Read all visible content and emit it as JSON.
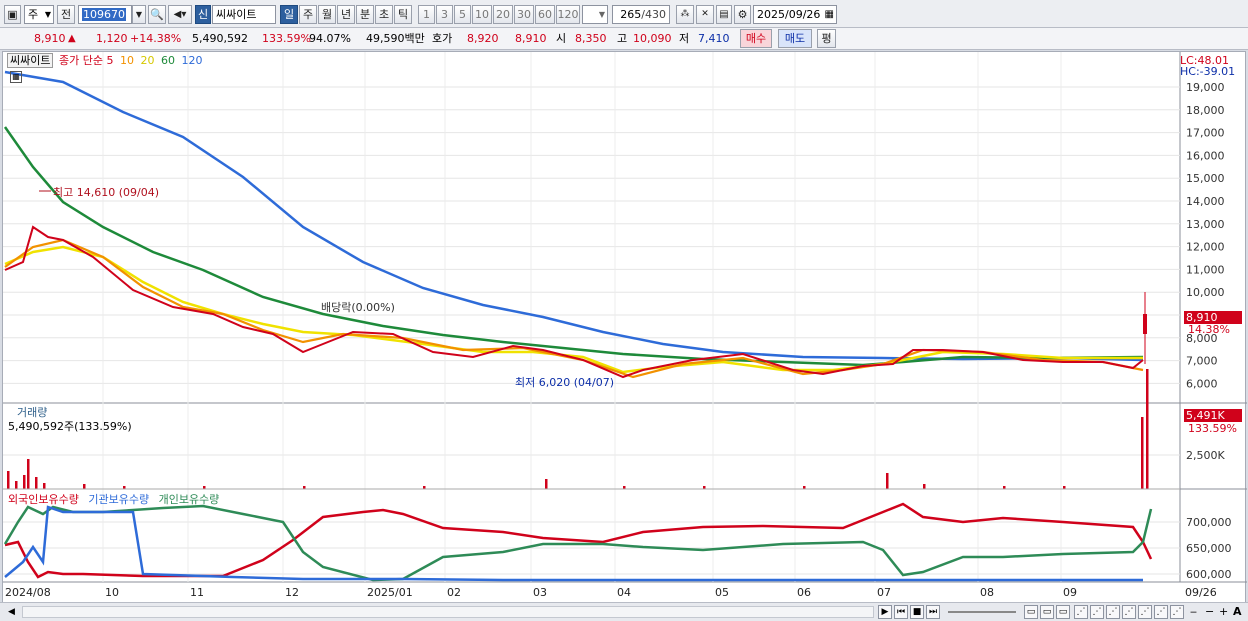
{
  "toolbar": {
    "period_dropdown": "주",
    "prev_label": "전",
    "code_value": "109670",
    "badge_label": "신",
    "stock_name": "씨싸이트",
    "period_tabs": [
      "일",
      "주",
      "월",
      "년",
      "분",
      "초",
      "틱"
    ],
    "interval_tabs": [
      "1",
      "3",
      "5",
      "10",
      "20",
      "30",
      "60",
      "120"
    ],
    "count_value": "265",
    "count_total": "/430",
    "date_value": "2025/09/26"
  },
  "quote": {
    "price": "8,910",
    "change": "1,120",
    "change_pct": "+14.38%",
    "volume": "5,490,592",
    "volume_ratio": "133.59%",
    "turnover_ratio": "94.07%",
    "amount": "49,590백만",
    "ask_label": "호가",
    "ask": "8,920",
    "bid": "8,910",
    "open_label": "시",
    "open": "8,350",
    "high_label": "고",
    "high": "10,090",
    "low_label": "저",
    "low": "7,410",
    "buy_label": "매수",
    "sell_label": "매도",
    "eval_label": "평"
  },
  "price_panel": {
    "legend_name": "씨싸이트",
    "legend_series": [
      {
        "label": "종가 단순 5",
        "color": "#d0021b"
      },
      {
        "label": "10",
        "color": "#f29100"
      },
      {
        "label": "20",
        "color": "#e8e000"
      },
      {
        "label": "60",
        "color": "#1e8a3a"
      },
      {
        "label": "120",
        "color": "#2e6bd8"
      }
    ],
    "lc_label": "LC:48.01",
    "hc_label": "HC:-39.01",
    "high_annotation": "최고 14,610 (09/04)",
    "low_annotation": "최저 6,020 (04/07)",
    "dividend_annotation": "배당락(0.00%)",
    "last_price_tag": "8,910",
    "last_change_tag": "14.38%",
    "y_ticks": [
      "19,000",
      "18,000",
      "17,000",
      "16,000",
      "15,000",
      "14,000",
      "13,000",
      "12,000",
      "11,000",
      "10,000",
      "9,000",
      "8,000",
      "7,000",
      "6,000"
    ]
  },
  "volume_panel": {
    "title": "거래량",
    "summary": "5,490,592주(133.59%)",
    "last_tag": "5,491K",
    "last_pct": "133.59%",
    "y_tick": "2,500K"
  },
  "holdings_panel": {
    "legend": [
      {
        "label": "외국인보유수량",
        "color": "#d0021b"
      },
      {
        "label": "기관보유수량",
        "color": "#2e6bd8"
      },
      {
        "label": "개인보유수량",
        "color": "#2e8b57"
      }
    ],
    "y_ticks": [
      "700,000",
      "650,000",
      "600,000"
    ]
  },
  "x_axis": {
    "labels": [
      "2024/08",
      "10",
      "11",
      "12",
      "2025/01",
      "02",
      "03",
      "04",
      "05",
      "06",
      "07",
      "08",
      "09",
      "09/26"
    ]
  }
}
